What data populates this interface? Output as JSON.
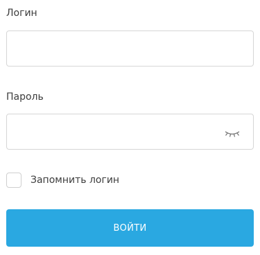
{
  "form": {
    "login": {
      "label": "Логин",
      "value": "",
      "placeholder": ""
    },
    "password": {
      "label": "Пароль",
      "value": "",
      "placeholder": "",
      "toggle_icon": "eye-closed-icon"
    },
    "remember": {
      "label": "Запомнить логин",
      "checked": false
    },
    "submit_label": "ВОЙТИ"
  },
  "colors": {
    "accent": "#2aa8e1",
    "border": "#d6d6d6",
    "text": "#3c3c3c"
  }
}
